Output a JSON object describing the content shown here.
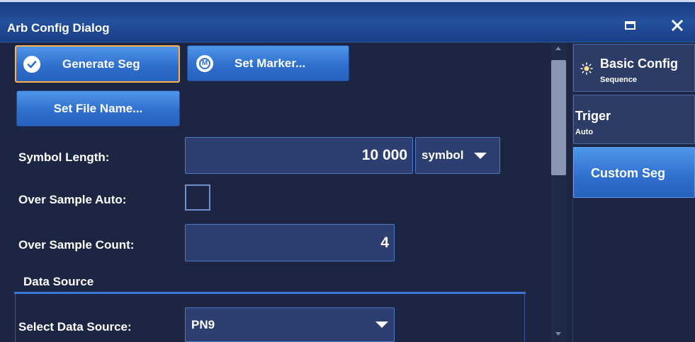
{
  "window": {
    "title": "Arb Config Dialog"
  },
  "buttons": {
    "generate_seg": "Generate Seg",
    "set_marker": "Set Marker...",
    "set_file_name": "Set File Name..."
  },
  "fields": {
    "symbol_length": {
      "label": "Symbol Length:",
      "value": "10 000",
      "unit": "symbol"
    },
    "over_sample_auto": {
      "label": "Over Sample Auto:",
      "checked": false
    },
    "over_sample_count": {
      "label": "Over Sample Count:",
      "value": "4"
    }
  },
  "data_source": {
    "section_title": "Data Source",
    "select_label": "Select Data Source:",
    "selected": "PN9"
  },
  "sidebar": {
    "tabs": [
      {
        "title": "Basic Config",
        "subtitle": "Sequence",
        "active": false
      },
      {
        "title": "Triger",
        "subtitle": "Auto",
        "active": false
      },
      {
        "title": "Custom Seg",
        "subtitle": "",
        "active": true
      }
    ]
  },
  "colors": {
    "background": "#1c2542",
    "title_bar": "#23509c",
    "button_blue": "#2f6fce",
    "focus_border": "#ffb14a",
    "field_bg": "#2c3f70",
    "field_border": "#4e79c6",
    "section_line": "#3a78d8"
  },
  "icons": {
    "generate_seg": "check-circle-icon",
    "set_marker": "marker-m-icon",
    "basic_config": "sun-icon",
    "window_maximize": "maximize-icon",
    "window_close": "close-icon"
  }
}
